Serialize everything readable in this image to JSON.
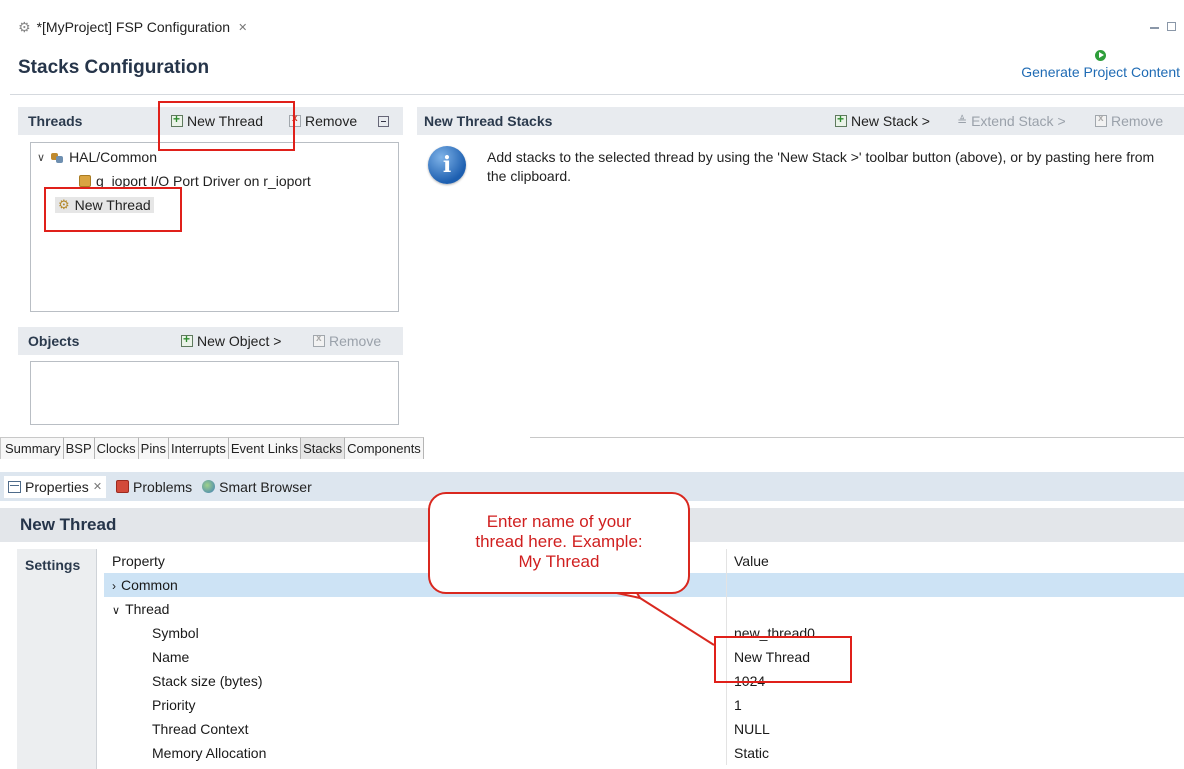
{
  "editor_tab": {
    "title": "*[MyProject] FSP Configuration",
    "close": "✕"
  },
  "page_title": "Stacks Configuration",
  "generate_label": "Generate Project Content",
  "threads_panel": {
    "title": "Threads",
    "new_thread": "New Thread",
    "remove": "Remove",
    "tree": [
      {
        "label": "HAL/Common",
        "expanded": true
      },
      {
        "label": "g_ioport I/O Port Driver on r_ioport"
      },
      {
        "label": "New Thread"
      }
    ]
  },
  "objects_panel": {
    "title": "Objects",
    "new_object": "New Object >",
    "remove": "Remove"
  },
  "stacks_panel": {
    "title": "New Thread Stacks",
    "new_stack": "New Stack >",
    "extend_stack": "Extend Stack >",
    "remove": "Remove",
    "info": "Add stacks to the selected thread by using the 'New Stack >' toolbar button (above), or by pasting here from the clipboard."
  },
  "editor_tabs": [
    "Summary",
    "BSP",
    "Clocks",
    "Pins",
    "Interrupts",
    "Event Links",
    "Stacks",
    "Components"
  ],
  "editor_tabs_selected": "Stacks",
  "view_tabs": {
    "properties": "Properties",
    "problems": "Problems",
    "smart_browser": "Smart Browser"
  },
  "properties": {
    "title": "New Thread",
    "settings_tab": "Settings",
    "col_property": "Property",
    "col_value": "Value",
    "rows": [
      {
        "property": "Common",
        "value": ""
      },
      {
        "property": "Thread",
        "value": ""
      },
      {
        "property": "Symbol",
        "value": "new_thread0"
      },
      {
        "property": "Name",
        "value": "New Thread"
      },
      {
        "property": "Stack size (bytes)",
        "value": "1024"
      },
      {
        "property": "Priority",
        "value": "1"
      },
      {
        "property": "Thread Context",
        "value": "NULL"
      },
      {
        "property": "Memory Allocation",
        "value": "Static"
      }
    ]
  },
  "callout": {
    "line1": "Enter name of your",
    "line2": "thread here. Example:",
    "line3": "My Thread"
  },
  "colors": {
    "annotation_red": "#e0201a",
    "link_blue": "#1f6bb4",
    "selection_blue": "#cde3f5"
  }
}
